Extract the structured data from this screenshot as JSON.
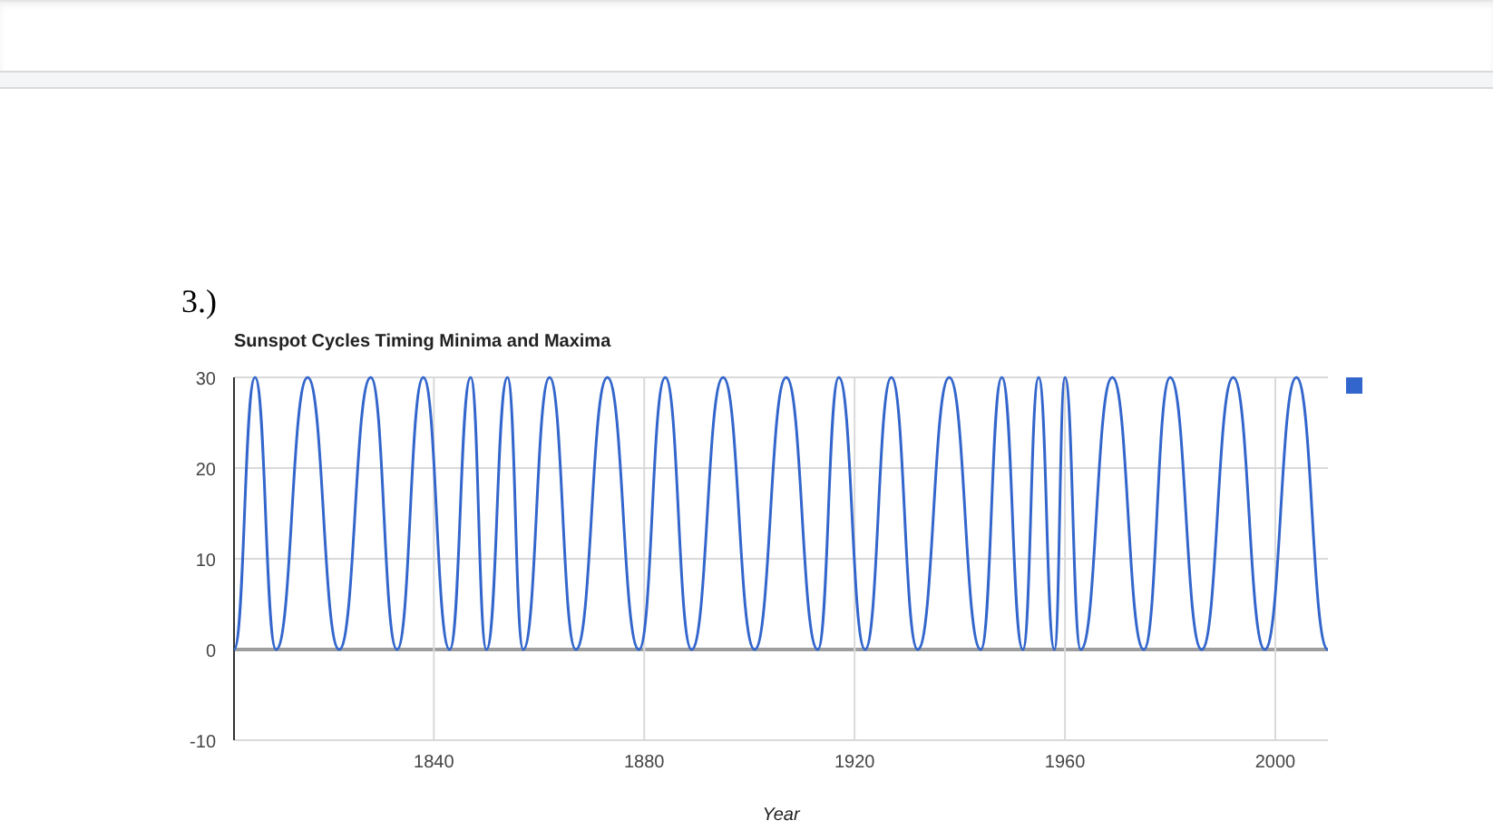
{
  "heading": "3.)",
  "chart": {
    "chart_data": {
      "type": "line",
      "title": "Sunspot Cycles Timing Minima and Maxima",
      "xlabel": "Year",
      "x": [
        1802,
        1806,
        1810,
        1816,
        1822,
        1828,
        1833,
        1838,
        1843,
        1847,
        1850,
        1854,
        1857,
        1862,
        1867,
        1873,
        1879,
        1884,
        1889,
        1895,
        1901,
        1907,
        1913,
        1917,
        1922,
        1927,
        1932,
        1938,
        1944,
        1948,
        1952,
        1955,
        1958,
        1960,
        1963,
        1969,
        1975,
        1980,
        1986,
        1992,
        1998,
        2004,
        2010
      ],
      "series": [
        {
          "color": "#3366cc",
          "values": [
            0,
            30,
            0,
            30,
            0,
            30,
            0,
            30,
            0,
            30,
            0,
            30,
            0,
            30,
            0,
            30,
            0,
            30,
            0,
            30,
            0,
            30,
            0,
            30,
            0,
            30,
            0,
            30,
            0,
            30,
            0,
            30,
            0,
            30,
            0,
            30,
            0,
            30,
            0,
            30,
            0,
            30,
            0
          ]
        }
      ],
      "grid": true,
      "xlim": [
        1802,
        2010
      ],
      "ylim": [
        -10,
        30
      ],
      "xticks": [
        1840,
        1880,
        1920,
        1960,
        2000
      ],
      "yticks": [
        -10,
        0,
        10,
        20,
        30
      ]
    }
  }
}
